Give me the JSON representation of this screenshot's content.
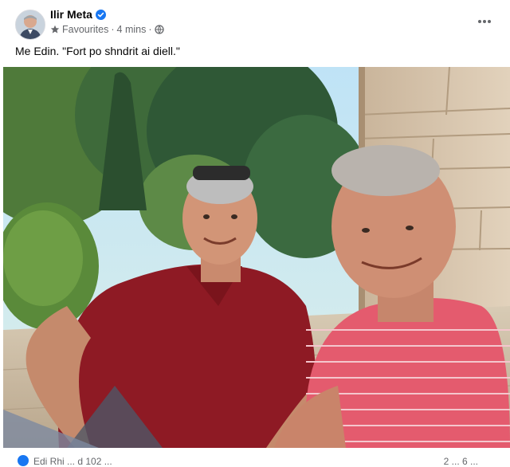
{
  "post": {
    "author": "Ilir Meta",
    "audience": "Favourites",
    "separator": "·",
    "time": "4 mins",
    "text": "Me Edin. \"Fort po shndrit ai diell.\""
  },
  "icons": {
    "verified": "verified-badge-icon",
    "favourites": "star-icon",
    "privacy": "globe-icon",
    "more": "more-options-icon"
  },
  "colors": {
    "verified": "#1877f2",
    "meta_text": "#65676b",
    "primary_text": "#050505"
  },
  "footer": {
    "reactions": "Edi Rhi ... d 102 ...",
    "counts": "2 ... 6 ..."
  }
}
